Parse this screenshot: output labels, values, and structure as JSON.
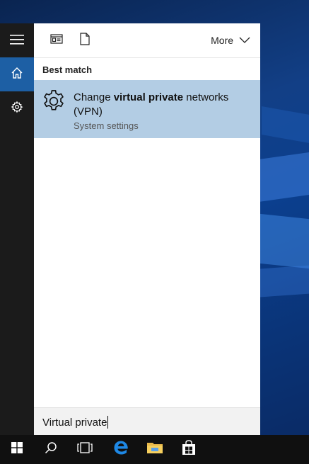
{
  "panel": {
    "more_label": "More",
    "best_match_label": "Best match",
    "result": {
      "title_part1": "Change ",
      "title_bold": "virtual private",
      "title_part2": " networks (VPN)",
      "subtitle": "System settings"
    },
    "search": {
      "value": "Virtual private"
    }
  },
  "colors": {
    "rail_bg": "#1b1b1b",
    "rail_active": "#1d5fa4",
    "result_highlight": "#b3cde4",
    "taskbar_bg": "#101010"
  },
  "icons": {
    "rail": [
      "hamburger-menu-icon",
      "home-icon",
      "gear-icon"
    ],
    "toolbar": [
      "apps-icon",
      "documents-icon",
      "chevron-down-icon"
    ],
    "taskbar": [
      "windows-start-icon",
      "search-icon",
      "task-view-icon",
      "edge-icon",
      "file-explorer-icon",
      "store-icon"
    ]
  }
}
